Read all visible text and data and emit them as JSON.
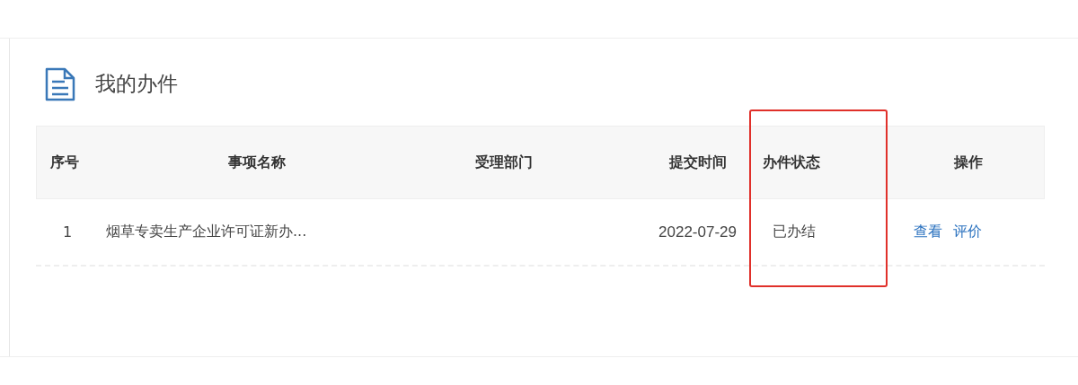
{
  "panel": {
    "title": "我的办件"
  },
  "table": {
    "columns": [
      {
        "label": "序号",
        "kind": "index",
        "highlighted": false
      },
      {
        "label": "事项名称",
        "kind": "name",
        "highlighted": false
      },
      {
        "label": "受理部门",
        "kind": "dept",
        "highlighted": false
      },
      {
        "label": "提交时间",
        "kind": "time",
        "highlighted": false
      },
      {
        "label": "办件状态",
        "kind": "status",
        "highlighted": true
      },
      {
        "label": "操作",
        "kind": "actions",
        "highlighted": false
      }
    ],
    "rows": [
      {
        "index": "1",
        "name": "烟草专卖生产企业许可证新办...",
        "time": "2022-07-29",
        "status": "已办结",
        "actions": [
          "查看",
          "评价"
        ]
      }
    ]
  }
}
